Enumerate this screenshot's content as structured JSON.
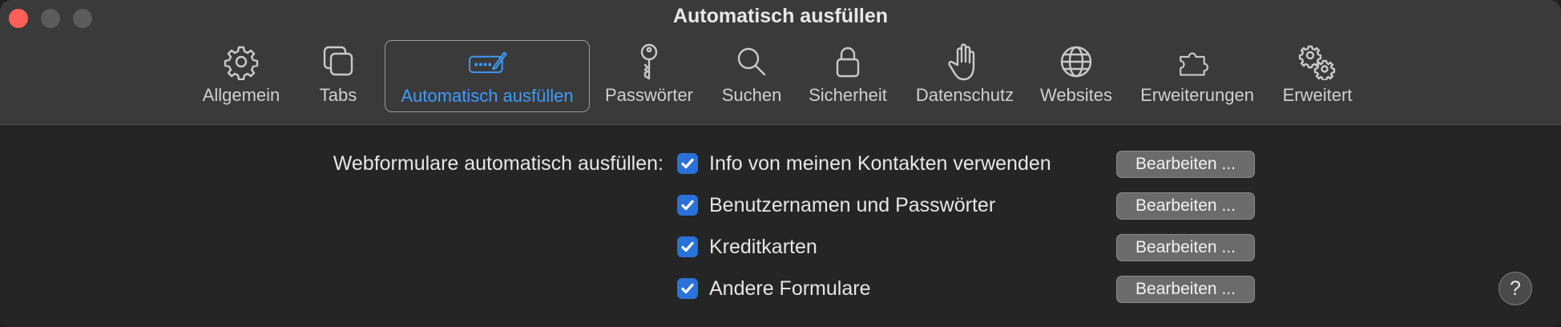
{
  "window": {
    "title": "Automatisch ausfüllen"
  },
  "toolbar": {
    "items": [
      {
        "label": "Allgemein",
        "icon": "gear-icon"
      },
      {
        "label": "Tabs",
        "icon": "tabs-icon"
      },
      {
        "label": "Automatisch ausfüllen",
        "icon": "autofill-icon",
        "active": true
      },
      {
        "label": "Passwörter",
        "icon": "key-icon"
      },
      {
        "label": "Suchen",
        "icon": "search-icon"
      },
      {
        "label": "Sicherheit",
        "icon": "lock-icon"
      },
      {
        "label": "Datenschutz",
        "icon": "hand-icon"
      },
      {
        "label": "Websites",
        "icon": "globe-icon"
      },
      {
        "label": "Erweiterungen",
        "icon": "puzzle-icon"
      },
      {
        "label": "Erweitert",
        "icon": "gears-icon"
      }
    ]
  },
  "autofill": {
    "section_label": "Webformulare automatisch ausfüllen:",
    "options": [
      {
        "label": "Info von meinen Kontakten verwenden",
        "checked": true,
        "button_label": "Bearbeiten ..."
      },
      {
        "label": "Benutzernamen und Passwörter",
        "checked": true,
        "button_label": "Bearbeiten ..."
      },
      {
        "label": "Kreditkarten",
        "checked": true,
        "button_label": "Bearbeiten ..."
      },
      {
        "label": "Andere Formulare",
        "checked": true,
        "button_label": "Bearbeiten ..."
      }
    ]
  },
  "help": {
    "label": "?"
  },
  "colors": {
    "accent": "#3d9bff",
    "checkbox": "#2a71d9",
    "close": "#ff5f57"
  }
}
